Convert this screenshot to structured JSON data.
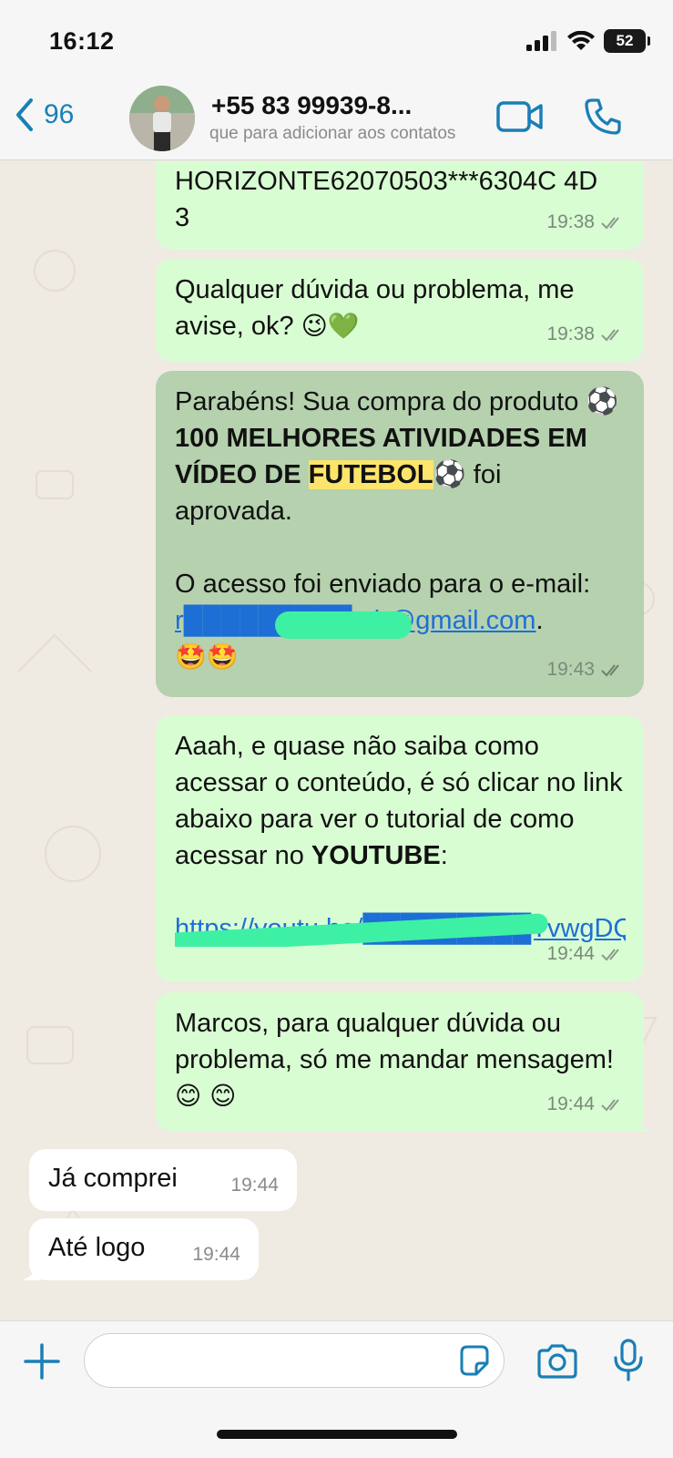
{
  "status_bar": {
    "time": "16:12",
    "battery": "52"
  },
  "header": {
    "back_count": "96",
    "contact_name": "+55 83 99939-8...",
    "contact_subtitle": "que para adicionar aos contatos"
  },
  "messages": [
    {
      "direction": "outgoing",
      "text": "HORIZONTE62070503***6304C 4D3",
      "time": "19:38",
      "status": "read"
    },
    {
      "direction": "outgoing",
      "text": "Qualquer dúvida ou problema, me avise, ok?",
      "emoji": "😉💚",
      "time": "19:38",
      "status": "read"
    },
    {
      "direction": "outgoing",
      "highlighted": true,
      "p1_a": "Parabéns! Sua compra do produto ",
      "p1_bold_a": "⚽100 MELHORES ATIVIDADES EM VÍDEO DE ",
      "p1_bold_highlight": "FUTEBOL",
      "p1_b": "⚽ foi aprovada.",
      "p2_a": "O acesso foi enviado para o e-mail: ",
      "email": "r█████████mb@gmail.com",
      "p2_b": ".",
      "emoji": "🤩🤩",
      "time": "19:43",
      "status": "read"
    },
    {
      "direction": "outgoing",
      "text_a": "Aaah, e quase não saiba como acessar o conteúdo, é só clicar no link abaixo para ver o tutorial de como acessar no ",
      "text_bold": "YOUTUBE",
      "text_b": ":",
      "link": "https://youtu.be/█████████TvwgDQA",
      "time": "19:44",
      "status": "read"
    },
    {
      "direction": "outgoing",
      "text": "Marcos, para qualquer dúvida ou problema, só me mandar mensagem!",
      "emoji": "😊 😊",
      "time": "19:44",
      "status": "read"
    },
    {
      "direction": "incoming",
      "text": "Já comprei",
      "time": "19:44"
    },
    {
      "direction": "incoming",
      "text": "Até logo",
      "time": "19:44"
    }
  ],
  "input": {
    "placeholder": ""
  },
  "colors": {
    "outgoing_bubble": "#d9fdd3",
    "highlighted_bubble": "#b5d1ae",
    "incoming_bubble": "#ffffff",
    "accent": "#1a7fb5",
    "chat_background": "#efeae2"
  }
}
